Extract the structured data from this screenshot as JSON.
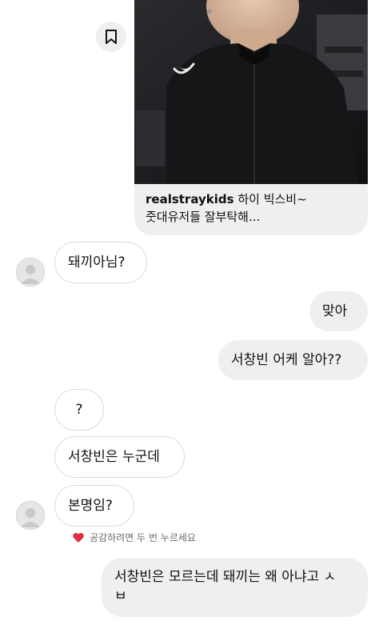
{
  "shared_post": {
    "username": "realstraykids",
    "caption_line1": "하이 빅스비~",
    "caption_line2": "줏대유저들 잘부탁해...",
    "save_icon": "bookmark-icon"
  },
  "messages": [
    {
      "text": "돼끼아님?"
    },
    {
      "text": "맞아"
    },
    {
      "text": "서창빈 어케 알아??"
    },
    {
      "text": "?"
    },
    {
      "text": "서창빈은 누군데"
    },
    {
      "text": "본명임?"
    },
    {
      "text": "서창빈은 모르는데 돼끼는 왜 아냐고 ㅅ"
    },
    {
      "text": "ㅂ"
    }
  ],
  "reaction_hint": {
    "icon": "heart-icon",
    "text": "공감하려면 두 번 누르세요",
    "color": "#e0303f"
  },
  "colors": {
    "incoming_bubble": "#ffffff",
    "outgoing_bubble": "#efefef"
  }
}
